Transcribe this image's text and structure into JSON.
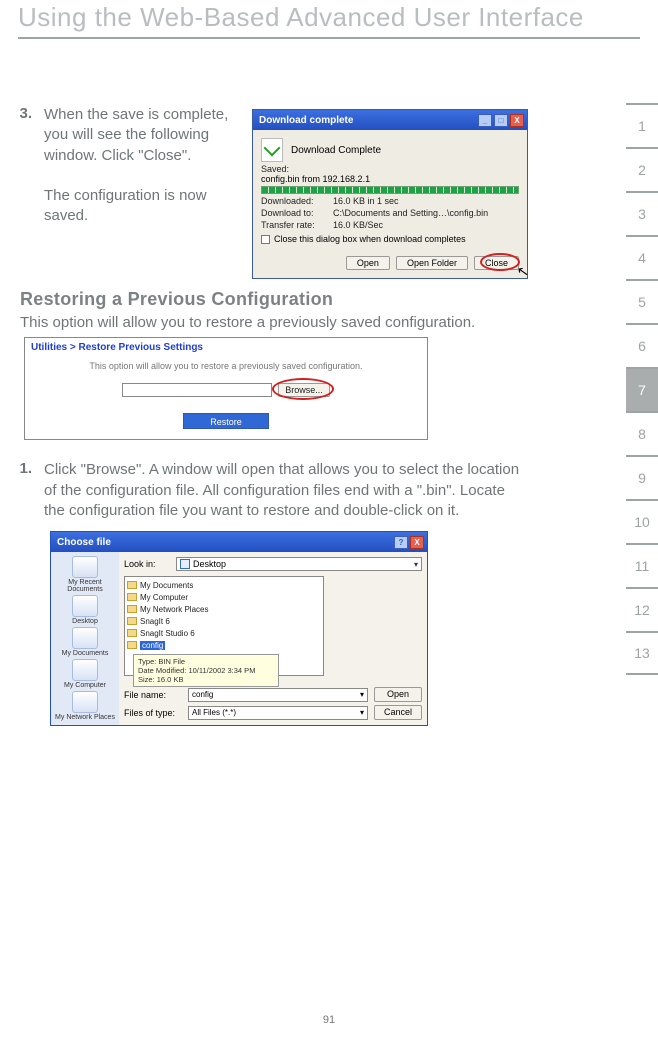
{
  "page": {
    "title": "Using the Web-Based Advanced User Interface",
    "number": "91"
  },
  "step3": {
    "num": "3.",
    "text": "When the save is complete, you will see the following window. Click \"Close\".",
    "follow": "The configuration is now saved."
  },
  "download_dialog": {
    "title": "Download complete",
    "heading": "Download Complete",
    "saved_label": "Saved:",
    "saved_value": "config.bin from 192.168.2.1",
    "rows": [
      {
        "k": "Downloaded:",
        "v": "16.0 KB in 1 sec"
      },
      {
        "k": "Download to:",
        "v": "C:\\Documents and Setting…\\config.bin"
      },
      {
        "k": "Transfer rate:",
        "v": "16.0 KB/Sec"
      }
    ],
    "checkbox": "Close this dialog box when download completes",
    "buttons": {
      "open": "Open",
      "open_folder": "Open Folder",
      "close": "Close"
    },
    "winbtns": {
      "min": "_",
      "max": "□",
      "close": "X"
    }
  },
  "restore": {
    "heading": "Restoring a Previous Configuration",
    "desc": "This option will allow you to restore a previously saved configuration.",
    "panel_title": "Utilities > Restore Previous Settings",
    "panel_desc": "This option will allow you to restore a previously saved configuration.",
    "browse": "Browse...",
    "restore_btn": "Restore"
  },
  "step1": {
    "num": "1.",
    "text": "Click \"Browse\". A window will open that allows you to select the location of the configuration file. All configuration files end with a \".bin\". Locate the configuration file you want to restore and double-click on it."
  },
  "choose_file": {
    "title": "Choose file",
    "lookin_label": "Look in:",
    "lookin_value": "Desktop",
    "left_items": [
      "My Recent Documents",
      "Desktop",
      "My Documents",
      "My Computer",
      "My Network Places"
    ],
    "list": [
      "My Documents",
      "My Computer",
      "My Network Places",
      "SnagIt 6",
      "SnagIt Studio 6"
    ],
    "selected": "config",
    "tooltip": {
      "l1": "Type: BIN File",
      "l2": "Date Modified: 10/11/2002 3:34 PM",
      "l3": "Size: 16.0 KB"
    },
    "filename_label": "File name:",
    "filename_value": "config",
    "filetype_label": "Files of type:",
    "filetype_value": "All Files (*.*)",
    "open": "Open",
    "cancel": "Cancel",
    "winbtns": {
      "help": "?",
      "close": "X"
    }
  },
  "side_index": {
    "items": [
      "1",
      "2",
      "3",
      "4",
      "5",
      "6",
      "7",
      "8",
      "9",
      "10",
      "11",
      "12",
      "13"
    ],
    "active": "7"
  }
}
